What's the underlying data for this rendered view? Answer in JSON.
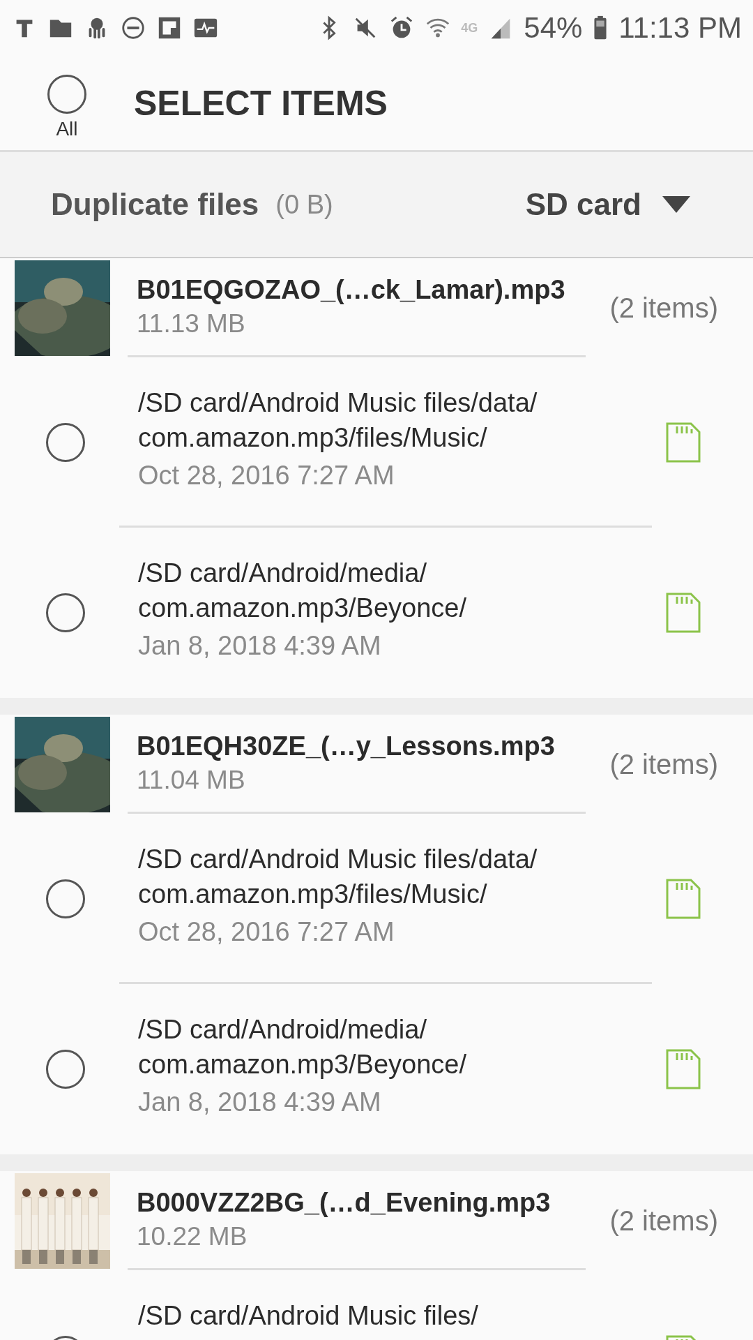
{
  "status_bar": {
    "network_type": "4G",
    "battery": "54%",
    "time": "11:13 PM"
  },
  "header": {
    "select_all": {
      "label": "All",
      "selected": false
    },
    "title": "SELECT ITEMS"
  },
  "filter_bar": {
    "label": "Duplicate files",
    "size": "(0 B)",
    "storage": "SD card"
  },
  "groups": [
    {
      "name": "B01EQGOZAO_(…ck_Lamar).mp3",
      "size": "11.13 MB",
      "count": "(2 items)",
      "entries": [
        {
          "path_lines": [
            "/SD card/Android Music files/data/",
            "com.amazon.mp3/files/Music/"
          ],
          "date": "Oct 28, 2016 7:27 AM",
          "selected": false
        },
        {
          "path_lines": [
            "/SD card/Android/media/",
            "com.amazon.mp3/Beyonce/"
          ],
          "date": "Jan 8, 2018 4:39 AM",
          "selected": false
        }
      ]
    },
    {
      "name": "B01EQH30ZE_(…y_Lessons.mp3",
      "size": "11.04 MB",
      "count": "(2 items)",
      "entries": [
        {
          "path_lines": [
            "/SD card/Android Music files/data/",
            "com.amazon.mp3/files/Music/"
          ],
          "date": "Oct 28, 2016 7:27 AM",
          "selected": false
        },
        {
          "path_lines": [
            "/SD card/Android/media/",
            "com.amazon.mp3/Beyonce/"
          ],
          "date": "Jan 8, 2018 4:39 AM",
          "selected": false
        }
      ]
    },
    {
      "name": "B000VZZ2BG_(…d_Evening.mp3",
      "size": "10.22 MB",
      "count": "(2 items)",
      "entries": [
        {
          "path_lines": [
            "/SD card/Android Music files/"
          ],
          "selected": false
        }
      ]
    }
  ]
}
